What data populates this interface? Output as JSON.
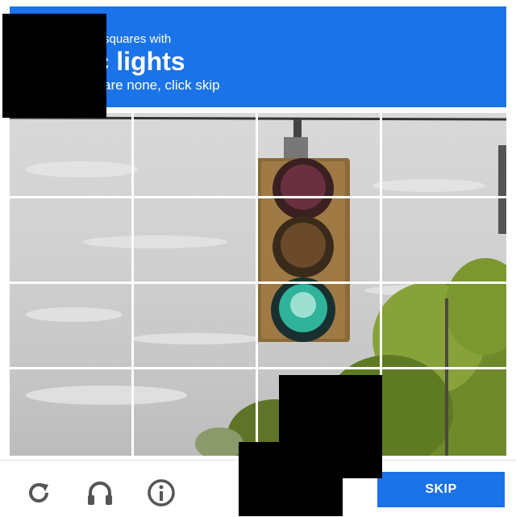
{
  "header": {
    "line1": "squares with",
    "line2": "fic lights",
    "line3": "are none, click skip"
  },
  "grid": {
    "rows": 4,
    "cols": 4,
    "image_subject": "traffic light against sky with trees"
  },
  "footer": {
    "reload_icon": "reload-icon",
    "audio_icon": "headphones-icon",
    "info_icon": "info-icon",
    "skip_label": "SKIP"
  },
  "colors": {
    "accent": "#1a73e8"
  }
}
